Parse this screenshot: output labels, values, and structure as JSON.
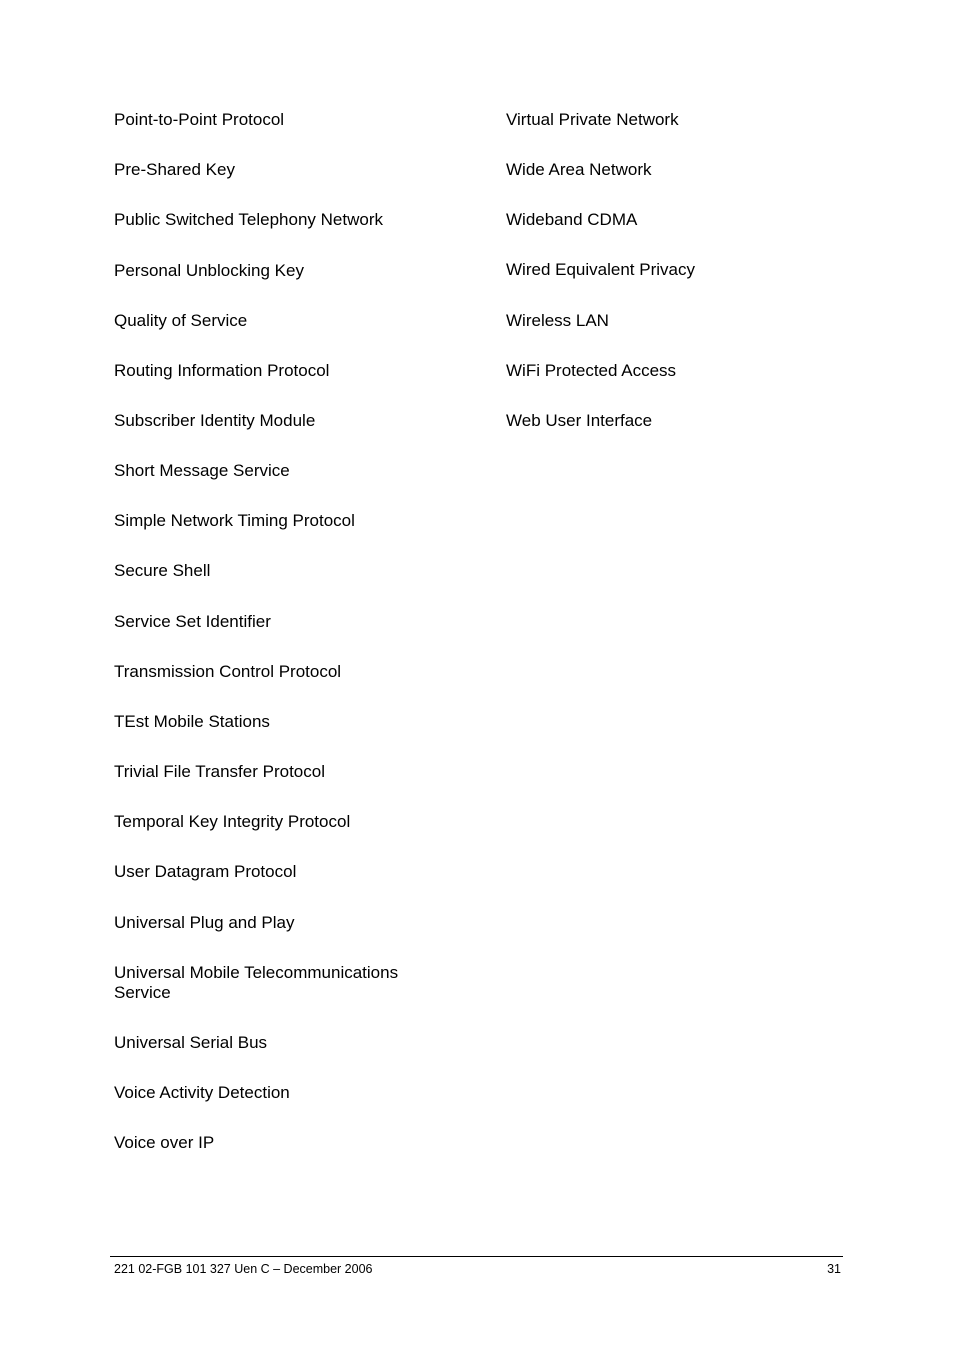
{
  "left_column": [
    "Point-to-Point Protocol",
    "Pre-Shared Key",
    "Public Switched Telephony Network",
    "Personal Unblocking Key",
    "Quality of Service",
    "Routing Information Protocol",
    "Subscriber Identity Module",
    "Short Message Service",
    "Simple Network Timing Protocol",
    "Secure Shell",
    "Service Set Identifier",
    "Transmission Control Protocol",
    "TEst Mobile Stations",
    "Trivial File Transfer Protocol",
    "Temporal Key Integrity Protocol",
    "User Datagram Protocol",
    "Universal Plug and Play",
    "Universal Mobile Telecommunications\nService",
    "Universal Serial Bus",
    "Voice Activity Detection",
    "Voice over IP"
  ],
  "right_column": [
    "Virtual Private Network",
    "Wide Area Network",
    "Wideband CDMA",
    "Wired Equivalent Privacy",
    "Wireless LAN",
    "WiFi Protected Access",
    "Web User Interface"
  ],
  "footer": {
    "document_id": "221 02-FGB 101 327 Uen C – December 2006",
    "page_number": "31"
  }
}
